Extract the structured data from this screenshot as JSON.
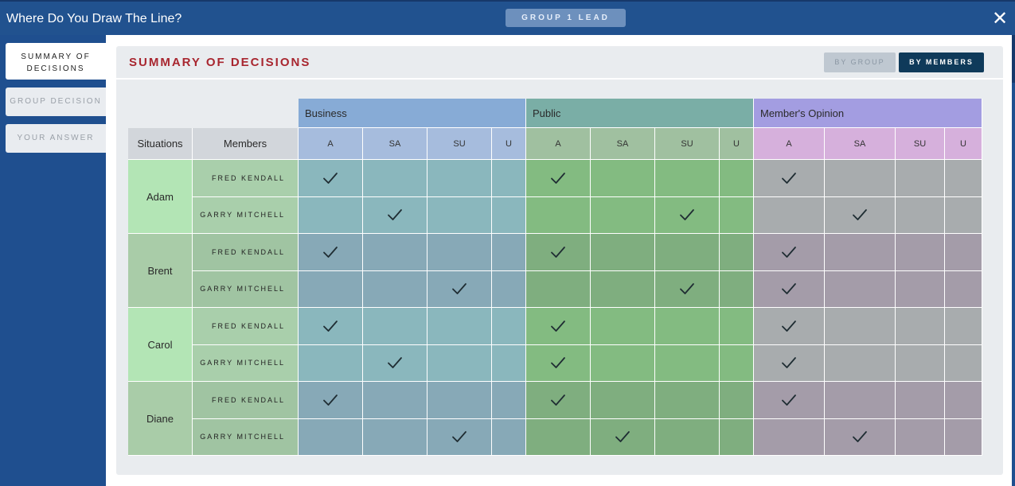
{
  "app": {
    "title": "Where Do You Draw The Line?",
    "role_badge": "GROUP 1 LEAD",
    "close_icon": "close-icon"
  },
  "sidebar": {
    "items": [
      {
        "label": "SUMMARY OF DECISIONS",
        "active": true
      },
      {
        "label": "GROUP DECISION",
        "active": false
      },
      {
        "label": "YOUR ANSWER",
        "active": false
      }
    ]
  },
  "summary": {
    "title": "SUMMARY OF DECISIONS",
    "toggle_by_group": "BY GROUP",
    "toggle_by_members": "BY MEMBERS",
    "selected_view": "BY MEMBERS"
  },
  "table": {
    "col_situations": "Situations",
    "col_members": "Members",
    "groups": [
      {
        "name": "Business",
        "options": [
          "A",
          "SA",
          "SU",
          "U"
        ],
        "header_color": "#87abd6",
        "sub_color": "#a6bcdd"
      },
      {
        "name": "Public",
        "options": [
          "A",
          "SA",
          "SU",
          "U"
        ],
        "header_color": "#7aaea6",
        "sub_color": "#a0c0a0"
      },
      {
        "name": "Member's Opinion",
        "options": [
          "A",
          "SA",
          "SU",
          "U"
        ],
        "header_color": "#a39de1",
        "sub_color": "#d6b0dc"
      }
    ],
    "situations": [
      {
        "name": "Adam",
        "rows": [
          {
            "member": "FRED KENDALL",
            "choices": {
              "Business": "A",
              "Public": "A",
              "Member's Opinion": "A"
            }
          },
          {
            "member": "GARRY MITCHELL",
            "choices": {
              "Business": "SA",
              "Public": "SU",
              "Member's Opinion": "SA"
            }
          }
        ]
      },
      {
        "name": "Brent",
        "rows": [
          {
            "member": "FRED KENDALL",
            "choices": {
              "Business": "A",
              "Public": "A",
              "Member's Opinion": "A"
            }
          },
          {
            "member": "GARRY MITCHELL",
            "choices": {
              "Business": "SU",
              "Public": "SU",
              "Member's Opinion": "A"
            }
          }
        ]
      },
      {
        "name": "Carol",
        "rows": [
          {
            "member": "FRED KENDALL",
            "choices": {
              "Business": "A",
              "Public": "A",
              "Member's Opinion": "A"
            }
          },
          {
            "member": "GARRY MITCHELL",
            "choices": {
              "Business": "SA",
              "Public": "A",
              "Member's Opinion": "A"
            }
          }
        ]
      },
      {
        "name": "Diane",
        "rows": [
          {
            "member": "FRED KENDALL",
            "choices": {
              "Business": "A",
              "Public": "A",
              "Member's Opinion": "A"
            }
          },
          {
            "member": "GARRY MITCHELL",
            "choices": {
              "Business": "SU",
              "Public": "SA",
              "Member's Opinion": "SA"
            }
          }
        ]
      }
    ],
    "colors": {
      "light": {
        "situation": "#b3e5b5",
        "member": "#a9cfab",
        "Business": "#8ab7bd",
        "Public": "#83bb81",
        "Member's Opinion": "#a8acae"
      },
      "dark": {
        "situation": "#a9cca8",
        "member": "#a0c4a2",
        "Business": "#87a9b7",
        "Public": "#7fae7f",
        "Member's Opinion": "#a49ca9"
      }
    }
  }
}
